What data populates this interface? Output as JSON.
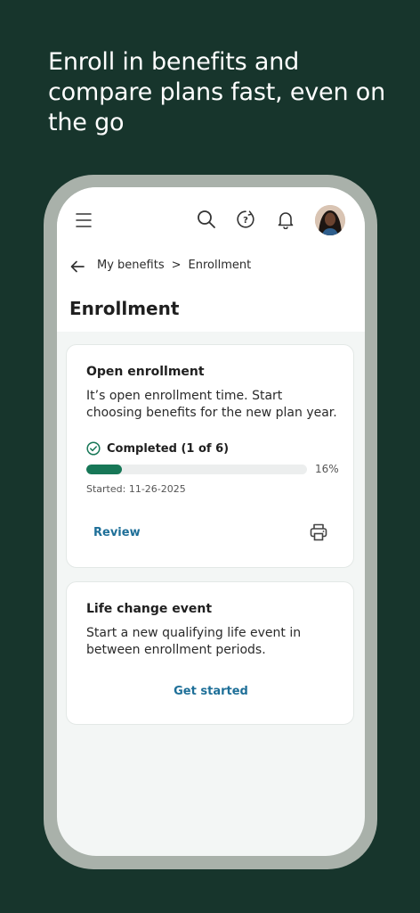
{
  "headline": "Enroll in benefits and compare plans fast, even on the go",
  "nav": {
    "breadcrumb": [
      "My benefits",
      "Enrollment"
    ],
    "breadcrumb_separator": ">",
    "page_title": "Enrollment"
  },
  "icons": [
    "menu-icon",
    "search-icon",
    "help-icon",
    "bell-icon",
    "avatar",
    "back-arrow-icon",
    "check-circle-icon",
    "printer-icon"
  ],
  "open_enrollment": {
    "title": "Open enrollment",
    "description": "It’s open enrollment time. Start choosing benefits for the new plan year.",
    "status": "Completed (1 of 6)",
    "progress_percent": 16,
    "progress_label": "16%",
    "started": "Started: 11-26-2025",
    "review_label": "Review"
  },
  "life_change": {
    "title": "Life change event",
    "description": "Start a new qualifying life event in between enrollment periods.",
    "action_label": "Get started"
  },
  "colors": {
    "background": "#17352c",
    "accent_green": "#177757",
    "link_blue": "#1e6f98"
  }
}
